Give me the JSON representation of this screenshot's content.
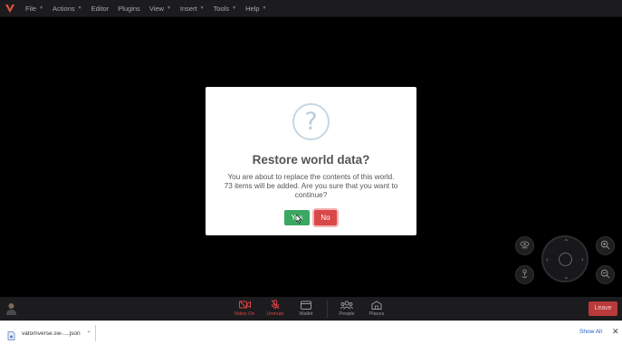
{
  "menu": {
    "items": [
      {
        "label": "File",
        "has_dropdown": true
      },
      {
        "label": "Actions",
        "has_dropdown": true
      },
      {
        "label": "Editor",
        "has_dropdown": false
      },
      {
        "label": "Plugins",
        "has_dropdown": false
      },
      {
        "label": "View",
        "has_dropdown": true
      },
      {
        "label": "Insert",
        "has_dropdown": true
      },
      {
        "label": "Tools",
        "has_dropdown": true
      },
      {
        "label": "Help",
        "has_dropdown": true
      }
    ]
  },
  "dialog": {
    "icon": "question-circle-icon",
    "title": "Restore world data?",
    "message": "You are about to replace the contents of this world. 73 items will be added. Are you sure that you want to continue?",
    "yes_label": "Yes",
    "no_label": "No"
  },
  "controls": {
    "view_icon": "eye-icon",
    "avatar_pose_icon": "person-pin-icon",
    "zoom_in_icon": "zoom-in-icon",
    "zoom_out_icon": "zoom-out-icon"
  },
  "toolbar": {
    "video": "Video On",
    "unmute": "Unmute",
    "wallet": "Wallet",
    "people": "People",
    "places": "Places",
    "leave": "Leave"
  },
  "downloads": {
    "file_name": "vatomverse.sw-....json",
    "show_all": "Show All"
  },
  "colors": {
    "yes": "#3aa862",
    "no": "#d94848",
    "leave": "#b83a3a",
    "alert_red": "#dd4444"
  }
}
